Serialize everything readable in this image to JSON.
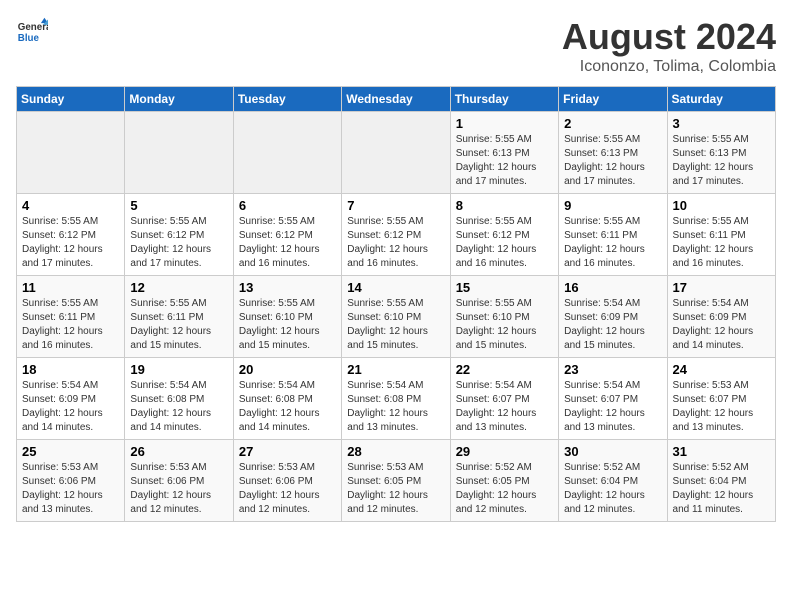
{
  "header": {
    "logo_line1": "General",
    "logo_line2": "Blue",
    "title": "August 2024",
    "subtitle": "Icononzo, Tolima, Colombia"
  },
  "days_of_week": [
    "Sunday",
    "Monday",
    "Tuesday",
    "Wednesday",
    "Thursday",
    "Friday",
    "Saturday"
  ],
  "weeks": [
    [
      {
        "num": "",
        "info": ""
      },
      {
        "num": "",
        "info": ""
      },
      {
        "num": "",
        "info": ""
      },
      {
        "num": "",
        "info": ""
      },
      {
        "num": "1",
        "info": "Sunrise: 5:55 AM\nSunset: 6:13 PM\nDaylight: 12 hours\nand 17 minutes."
      },
      {
        "num": "2",
        "info": "Sunrise: 5:55 AM\nSunset: 6:13 PM\nDaylight: 12 hours\nand 17 minutes."
      },
      {
        "num": "3",
        "info": "Sunrise: 5:55 AM\nSunset: 6:13 PM\nDaylight: 12 hours\nand 17 minutes."
      }
    ],
    [
      {
        "num": "4",
        "info": "Sunrise: 5:55 AM\nSunset: 6:12 PM\nDaylight: 12 hours\nand 17 minutes."
      },
      {
        "num": "5",
        "info": "Sunrise: 5:55 AM\nSunset: 6:12 PM\nDaylight: 12 hours\nand 17 minutes."
      },
      {
        "num": "6",
        "info": "Sunrise: 5:55 AM\nSunset: 6:12 PM\nDaylight: 12 hours\nand 16 minutes."
      },
      {
        "num": "7",
        "info": "Sunrise: 5:55 AM\nSunset: 6:12 PM\nDaylight: 12 hours\nand 16 minutes."
      },
      {
        "num": "8",
        "info": "Sunrise: 5:55 AM\nSunset: 6:12 PM\nDaylight: 12 hours\nand 16 minutes."
      },
      {
        "num": "9",
        "info": "Sunrise: 5:55 AM\nSunset: 6:11 PM\nDaylight: 12 hours\nand 16 minutes."
      },
      {
        "num": "10",
        "info": "Sunrise: 5:55 AM\nSunset: 6:11 PM\nDaylight: 12 hours\nand 16 minutes."
      }
    ],
    [
      {
        "num": "11",
        "info": "Sunrise: 5:55 AM\nSunset: 6:11 PM\nDaylight: 12 hours\nand 16 minutes."
      },
      {
        "num": "12",
        "info": "Sunrise: 5:55 AM\nSunset: 6:11 PM\nDaylight: 12 hours\nand 15 minutes."
      },
      {
        "num": "13",
        "info": "Sunrise: 5:55 AM\nSunset: 6:10 PM\nDaylight: 12 hours\nand 15 minutes."
      },
      {
        "num": "14",
        "info": "Sunrise: 5:55 AM\nSunset: 6:10 PM\nDaylight: 12 hours\nand 15 minutes."
      },
      {
        "num": "15",
        "info": "Sunrise: 5:55 AM\nSunset: 6:10 PM\nDaylight: 12 hours\nand 15 minutes."
      },
      {
        "num": "16",
        "info": "Sunrise: 5:54 AM\nSunset: 6:09 PM\nDaylight: 12 hours\nand 15 minutes."
      },
      {
        "num": "17",
        "info": "Sunrise: 5:54 AM\nSunset: 6:09 PM\nDaylight: 12 hours\nand 14 minutes."
      }
    ],
    [
      {
        "num": "18",
        "info": "Sunrise: 5:54 AM\nSunset: 6:09 PM\nDaylight: 12 hours\nand 14 minutes."
      },
      {
        "num": "19",
        "info": "Sunrise: 5:54 AM\nSunset: 6:08 PM\nDaylight: 12 hours\nand 14 minutes."
      },
      {
        "num": "20",
        "info": "Sunrise: 5:54 AM\nSunset: 6:08 PM\nDaylight: 12 hours\nand 14 minutes."
      },
      {
        "num": "21",
        "info": "Sunrise: 5:54 AM\nSunset: 6:08 PM\nDaylight: 12 hours\nand 13 minutes."
      },
      {
        "num": "22",
        "info": "Sunrise: 5:54 AM\nSunset: 6:07 PM\nDaylight: 12 hours\nand 13 minutes."
      },
      {
        "num": "23",
        "info": "Sunrise: 5:54 AM\nSunset: 6:07 PM\nDaylight: 12 hours\nand 13 minutes."
      },
      {
        "num": "24",
        "info": "Sunrise: 5:53 AM\nSunset: 6:07 PM\nDaylight: 12 hours\nand 13 minutes."
      }
    ],
    [
      {
        "num": "25",
        "info": "Sunrise: 5:53 AM\nSunset: 6:06 PM\nDaylight: 12 hours\nand 13 minutes."
      },
      {
        "num": "26",
        "info": "Sunrise: 5:53 AM\nSunset: 6:06 PM\nDaylight: 12 hours\nand 12 minutes."
      },
      {
        "num": "27",
        "info": "Sunrise: 5:53 AM\nSunset: 6:06 PM\nDaylight: 12 hours\nand 12 minutes."
      },
      {
        "num": "28",
        "info": "Sunrise: 5:53 AM\nSunset: 6:05 PM\nDaylight: 12 hours\nand 12 minutes."
      },
      {
        "num": "29",
        "info": "Sunrise: 5:52 AM\nSunset: 6:05 PM\nDaylight: 12 hours\nand 12 minutes."
      },
      {
        "num": "30",
        "info": "Sunrise: 5:52 AM\nSunset: 6:04 PM\nDaylight: 12 hours\nand 12 minutes."
      },
      {
        "num": "31",
        "info": "Sunrise: 5:52 AM\nSunset: 6:04 PM\nDaylight: 12 hours\nand 11 minutes."
      }
    ]
  ]
}
